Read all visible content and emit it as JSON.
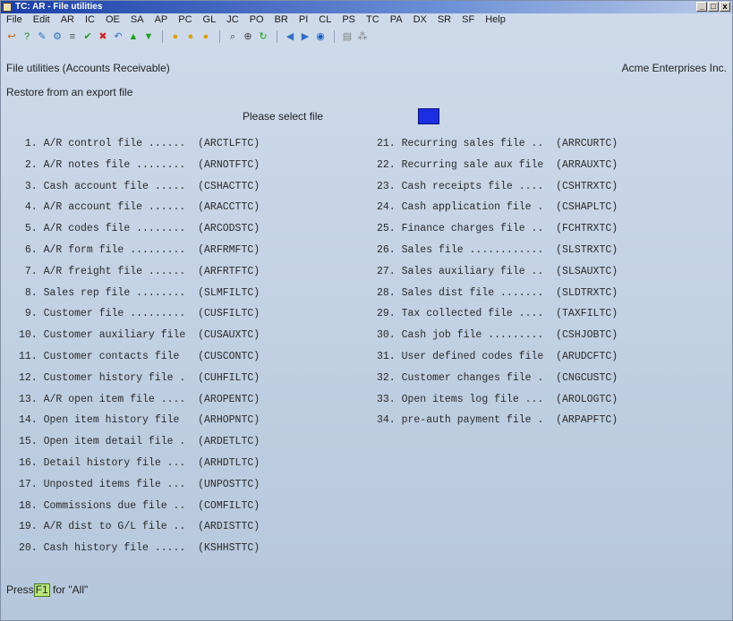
{
  "window": {
    "title": "TC: AR - File utilities",
    "buttons": [
      "_",
      "□",
      "x"
    ]
  },
  "menu": [
    "File",
    "Edit",
    "AR",
    "IC",
    "OE",
    "SA",
    "AP",
    "PC",
    "GL",
    "JC",
    "PO",
    "BR",
    "PI",
    "CL",
    "PS",
    "TC",
    "PA",
    "DX",
    "SR",
    "SF",
    "Help"
  ],
  "toolbar": [
    "exit-icon",
    "help-icon",
    "tools-icon",
    "settings-icon",
    "print-icon",
    "check-icon",
    "cancel-icon",
    "undo-icon",
    "up-icon",
    "down-icon",
    "first-icon",
    "prev-record-icon",
    "next-record-icon",
    "find-icon",
    "zoom-icon",
    "refresh-icon",
    "back-icon",
    "forward-icon",
    "globe-icon",
    "calc-icon",
    "tree-icon"
  ],
  "header": {
    "left": "File utilities (Accounts Receivable)",
    "right": "Acme Enterprises Inc."
  },
  "subtitle": "Restore from an export file",
  "prompt": "Please select file",
  "files_left": [
    " 1. A/R control file ......  (ARCTLFTC)",
    " 2. A/R notes file ........  (ARNOTFTC)",
    " 3. Cash account file .....  (CSHACTTC)",
    " 4. A/R account file ......  (ARACCTTC)",
    " 5. A/R codes file ........  (ARCODSTC)",
    " 6. A/R form file .........  (ARFRMFTC)",
    " 7. A/R freight file ......  (ARFRTFTC)",
    " 8. Sales rep file ........  (SLMFILTC)",
    " 9. Customer file .........  (CUSFILTC)",
    "10. Customer auxiliary file  (CUSAUXTC)",
    "11. Customer contacts file   (CUSCONTC)",
    "12. Customer history file .  (CUHFILTC)",
    "13. A/R open item file ....  (AROPENTC)",
    "14. Open item history file   (ARHOPNTC)",
    "15. Open item detail file .  (ARDETLTC)",
    "16. Detail history file ...  (ARHDTLTC)",
    "17. Unposted items file ...  (UNPOSTTC)",
    "18. Commissions due file ..  (COMFILTC)",
    "19. A/R dist to G/L file ..  (ARDISTTC)",
    "20. Cash history file .....  (KSHHSTTC)"
  ],
  "files_right": [
    "21. Recurring sales file ..  (ARRCURTC)",
    "22. Recurring sale aux file  (ARRAUXTC)",
    "23. Cash receipts file ....  (CSHTRXTC)",
    "24. Cash application file .  (CSHAPLTC)",
    "25. Finance charges file ..  (FCHTRXTC)",
    "26. Sales file ............  (SLSTRXTC)",
    "27. Sales auxiliary file ..  (SLSAUXTC)",
    "28. Sales dist file .......  (SLDTRXTC)",
    "29. Tax collected file ....  (TAXFILTC)",
    "30. Cash job file .........  (CSHJOBTC)",
    "31. User defined codes file  (ARUDCFTC)",
    "32. Customer changes file .  (CNGCUSTC)",
    "33. Open items log file ...  (AROLOGTC)",
    "34. pre-auth payment file .  (ARPAPFTC)"
  ],
  "footer": {
    "pre": "Press",
    "key": "F1",
    "post": "for \"All\""
  },
  "colors": {
    "select_box": "#1c2ee0",
    "f1_highlight": "#b8e87c"
  }
}
